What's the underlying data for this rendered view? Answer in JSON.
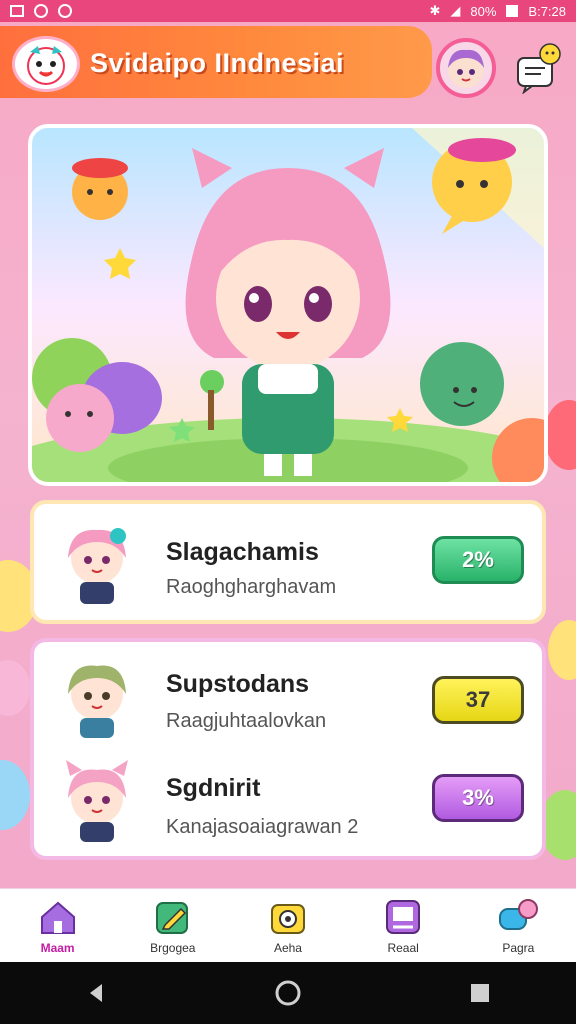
{
  "status_bar": {
    "battery": "80%",
    "time": "B:7:28"
  },
  "header": {
    "title": "Svidaipo IIndnesiai"
  },
  "featured": {
    "title": "Slagachamis",
    "subtitle": "Raoghgharghavam",
    "badge": "2%"
  },
  "list": [
    {
      "title": "Supstodans",
      "subtitle": "Raagjuhtaalovkan",
      "badge": "37"
    },
    {
      "title": "Sgdnirit",
      "subtitle": "Kanajasoaiagrawan  2",
      "badge": "3%"
    }
  ],
  "bottom_nav": [
    {
      "label": "Maam",
      "icon": "home-icon",
      "active": true
    },
    {
      "label": "Brgogea",
      "icon": "edit-icon",
      "active": false
    },
    {
      "label": "Aeha",
      "icon": "camera-icon",
      "active": false
    },
    {
      "label": "Reaal",
      "icon": "gallery-icon",
      "active": false
    },
    {
      "label": "Pagra",
      "icon": "chat-icon",
      "active": false
    }
  ],
  "colors": {
    "header": "#ff7a3d",
    "accent_pink": "#f55d96",
    "badge_green": "#39c07a",
    "badge_yellow": "#f2e53a",
    "badge_purple": "#c070e7"
  }
}
